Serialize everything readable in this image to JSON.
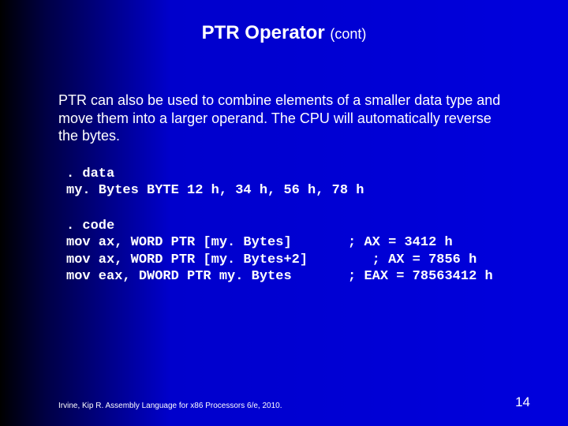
{
  "title": {
    "main": "PTR Operator",
    "sub": "(cont)"
  },
  "description": "PTR can also be used to combine elements of a smaller data type and move them into a larger operand. The CPU will automatically reverse the bytes.",
  "code_data": ". data\nmy. Bytes BYTE 12 h, 34 h, 56 h, 78 h",
  "code_code": ". code\nmov ax, WORD PTR [my. Bytes]       ; AX = 3412 h\nmov ax, WORD PTR [my. Bytes+2]        ; AX = 7856 h\nmov eax, DWORD PTR my. Bytes       ; EAX = 78563412 h",
  "footer": "Irvine, Kip R. Assembly Language for x86 Processors 6/e, 2010.",
  "page_number": "14"
}
